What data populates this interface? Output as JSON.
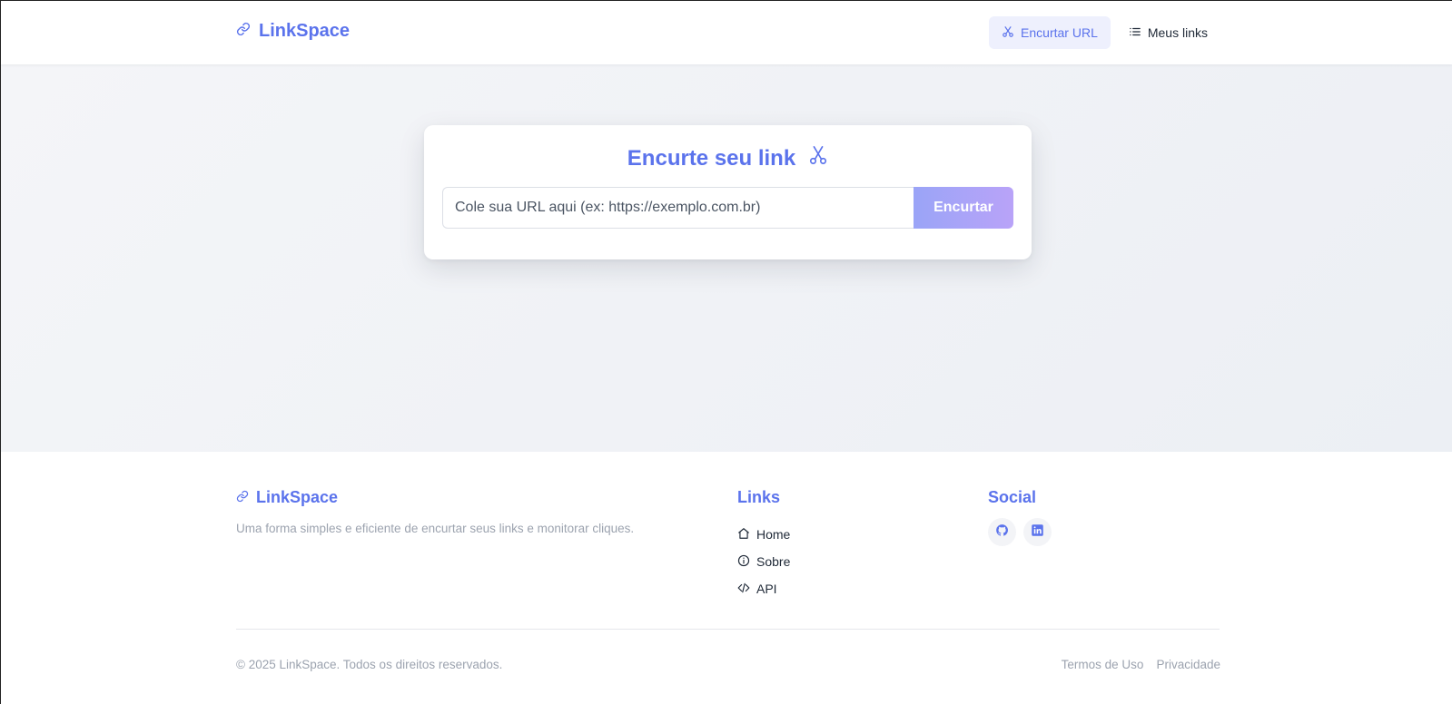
{
  "header": {
    "brand": "LinkSpace",
    "nav": [
      {
        "label": "Encurtar URL",
        "icon": "scissors-icon",
        "active": true
      },
      {
        "label": "Meus links",
        "icon": "list-icon",
        "active": false
      }
    ]
  },
  "hero": {
    "title": "Encurte seu link",
    "title_icon": "scissors-icon",
    "input_placeholder": "Cole sua URL aqui (ex: https://exemplo.com.br)",
    "input_value": "",
    "button_label": "Encurtar"
  },
  "footer": {
    "brand": "LinkSpace",
    "description": "Uma forma simples e eficiente de encurtar seus links e monitorar cliques.",
    "links_title": "Links",
    "links": [
      {
        "label": "Home",
        "icon": "home-icon"
      },
      {
        "label": "Sobre",
        "icon": "info-icon"
      },
      {
        "label": "API",
        "icon": "code-icon"
      }
    ],
    "social_title": "Social",
    "social": [
      {
        "icon": "github-icon"
      },
      {
        "icon": "linkedin-icon"
      }
    ],
    "copyright": "© 2025 LinkSpace. Todos os direitos reservados.",
    "legal": [
      "Termos de Uso",
      "Privacidade"
    ]
  },
  "colors": {
    "accent": "#5b73ec",
    "button_gradient_start": "#9aa4f7",
    "button_gradient_end": "#b9a3f8",
    "muted_text": "#9ca3af"
  }
}
